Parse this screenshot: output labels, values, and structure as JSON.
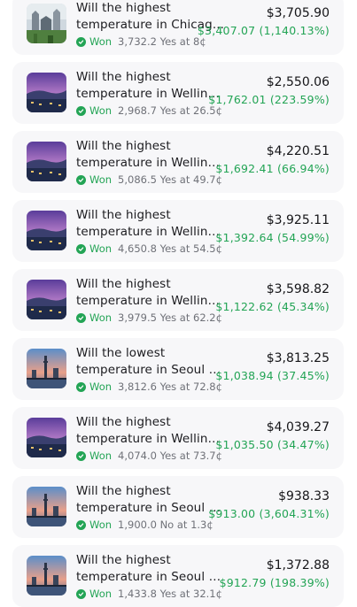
{
  "positions": [
    {
      "title_line1": "Will the highest",
      "title_line2": "temperature in Chicag...",
      "thumb": "chicago",
      "status": "Won",
      "shares": "3,732.2 Yes at 8¢",
      "value": "$3,705.90",
      "gain": "$3,407.07 (1,140.13%)"
    },
    {
      "title_line1": "Will the highest",
      "title_line2": "temperature in Wellingto...",
      "thumb": "wellington",
      "status": "Won",
      "shares": "2,968.7 Yes at 26.5¢",
      "value": "$2,550.06",
      "gain": "$1,762.01 (223.59%)"
    },
    {
      "title_line1": "Will the highest",
      "title_line2": "temperature in Wellingto...",
      "thumb": "wellington",
      "status": "Won",
      "shares": "5,086.5 Yes at 49.7¢",
      "value": "$4,220.51",
      "gain": "$1,692.41 (66.94%)"
    },
    {
      "title_line1": "Will the highest",
      "title_line2": "temperature in Wellingto...",
      "thumb": "wellington",
      "status": "Won",
      "shares": "4,650.8 Yes at 54.5¢",
      "value": "$3,925.11",
      "gain": "$1,392.64 (54.99%)"
    },
    {
      "title_line1": "Will the highest",
      "title_line2": "temperature in Wellingto...",
      "thumb": "wellington",
      "status": "Won",
      "shares": "3,979.5 Yes at 62.2¢",
      "value": "$3,598.82",
      "gain": "$1,122.62 (45.34%)"
    },
    {
      "title_line1": "Will the lowest",
      "title_line2": "temperature in Seoul be...",
      "thumb": "seoul",
      "status": "Won",
      "shares": "3,812.6 Yes at 72.8¢",
      "value": "$3,813.25",
      "gain": "$1,038.94 (37.45%)"
    },
    {
      "title_line1": "Will the highest",
      "title_line2": "temperature in Wellingto...",
      "thumb": "wellington",
      "status": "Won",
      "shares": "4,074.0 Yes at 73.7¢",
      "value": "$4,039.27",
      "gain": "$1,035.50 (34.47%)"
    },
    {
      "title_line1": "Will the highest",
      "title_line2": "temperature in Seoul be...",
      "thumb": "seoul",
      "status": "Won",
      "shares": "1,900.0 No at 1.3¢",
      "value": "$938.33",
      "gain": "$913.00 (3,604.31%)"
    },
    {
      "title_line1": "Will the highest",
      "title_line2": "temperature in Seoul be...",
      "thumb": "seoul",
      "status": "Won",
      "shares": "1,433.8 Yes at 32.1¢",
      "value": "$1,372.88",
      "gain": "$912.79 (198.39%)"
    }
  ],
  "colors": {
    "won_green": "#23a455",
    "card_bg": "#f7f7f9"
  }
}
